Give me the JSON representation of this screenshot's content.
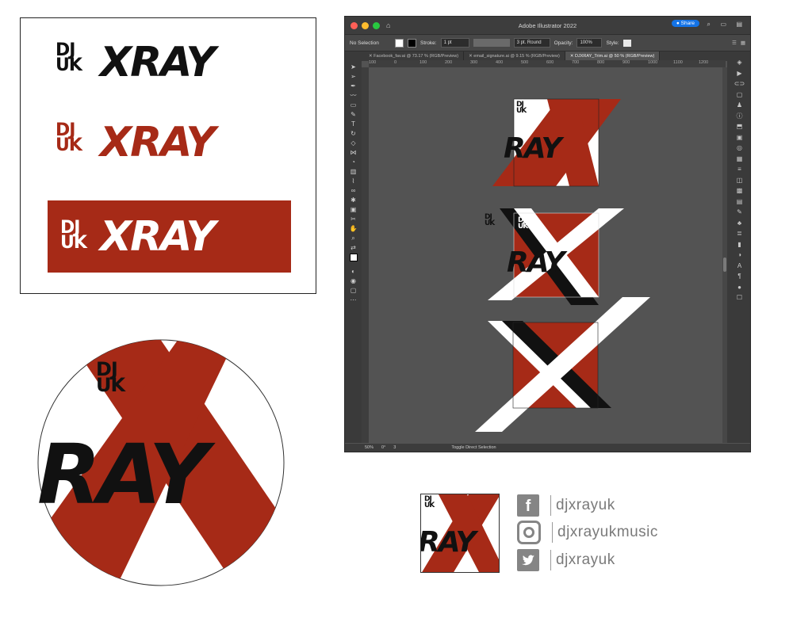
{
  "colors": {
    "brand_red": "#a62a17",
    "black": "#111111",
    "white": "#ffffff",
    "gray": "#858585"
  },
  "logo": {
    "mark_top": "DJ",
    "mark_bottom": "UK",
    "wordmark": "XRAY",
    "short_wordmark": "RAY"
  },
  "illustrator": {
    "title": "Adobe Illustrator 2022",
    "share_label": "Share",
    "selection_label": "No Selection",
    "stroke_label": "Stroke:",
    "stroke_value": "1 pt",
    "brush_value": "3 pt. Round",
    "opacity_label": "Opacity:",
    "opacity_value": "100%",
    "style_label": "Style:",
    "tabs": [
      {
        "label": "Facebook_fav.ai @ 73.17 % (RGB/Preview)"
      },
      {
        "label": "email_signature.ai @ 9.15 % (RGB/Preview)"
      },
      {
        "label": "DJXRAY_Trim.ai @ 50 % (RGB/Preview)"
      }
    ],
    "ruler_ticks": [
      "100",
      "0",
      "100",
      "200",
      "300",
      "400",
      "500",
      "600",
      "700",
      "800",
      "900",
      "1000",
      "1100",
      "1200"
    ],
    "status": {
      "zoom": "50%",
      "rotation": "0°",
      "artboard": "3",
      "message": "Toggle Direct Selection"
    }
  },
  "social": [
    {
      "icon": "facebook-icon",
      "handle": "djxrayuk"
    },
    {
      "icon": "instagram-icon",
      "handle": "djxrayukmusic"
    },
    {
      "icon": "twitter-icon",
      "handle": "djxrayuk"
    }
  ]
}
